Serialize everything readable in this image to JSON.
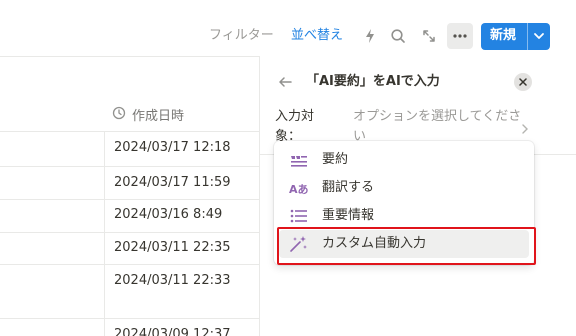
{
  "toolbar": {
    "filter_label": "フィルター",
    "sort_label": "並べ替え",
    "new_label": "新規",
    "icons": [
      "lightning-icon",
      "search-icon",
      "expand-icon",
      "more-icon",
      "chevron-down-icon"
    ]
  },
  "table": {
    "column_header": "作成日時",
    "rows": [
      "2024/03/17 12:18",
      "2024/03/17 11:59",
      "2024/03/16 8:49",
      "2024/03/11 22:35",
      "2024/03/11 22:33",
      "2024/03/09 12:37"
    ]
  },
  "panel": {
    "title": "「AI要約」をAIで入力",
    "target_label": "入力対象：",
    "target_placeholder": "オプションを選択してください"
  },
  "menu": {
    "items": [
      {
        "label": "要約",
        "icon": "summary-icon"
      },
      {
        "label": "翻訳する",
        "icon": "translate-icon"
      },
      {
        "label": "重要情報",
        "icon": "list-icon"
      },
      {
        "label": "カスタム自動入力",
        "icon": "sparkles-icon"
      }
    ]
  },
  "colors": {
    "accent": "#2383e2",
    "menu_icon": "#9065b0",
    "highlight": "#e0141b"
  }
}
